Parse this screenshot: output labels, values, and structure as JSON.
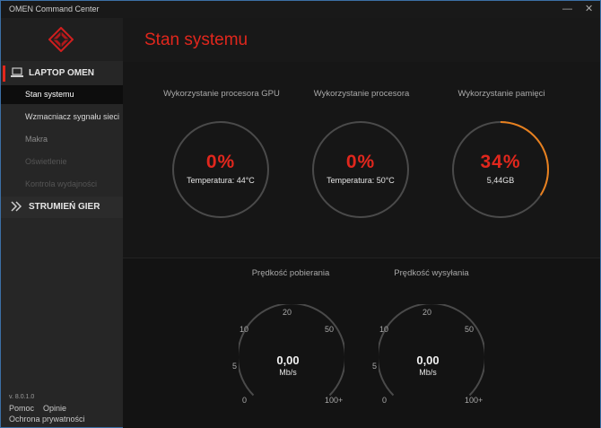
{
  "window": {
    "title": "OMEN Command Center"
  },
  "colors": {
    "accent": "#e1271d",
    "ring_progress": "#e8801e",
    "ring_track": "#4a4a4a"
  },
  "sidebar": {
    "sections": [
      {
        "label": "LAPTOP OMEN",
        "icon": "laptop-icon"
      },
      {
        "label": "STRUMIEŃ GIER",
        "icon": "stream-icon"
      }
    ],
    "items": [
      {
        "label": "Stan systemu",
        "state": "active"
      },
      {
        "label": "Wzmacniacz sygnału sieci",
        "state": "normal"
      },
      {
        "label": "Makra",
        "state": "dim"
      },
      {
        "label": "Oświetlenie",
        "state": "disabled"
      },
      {
        "label": "Kontrola wydajności",
        "state": "disabled"
      }
    ],
    "version": "v. 8.0.1.0",
    "links": {
      "help": "Pomoc",
      "feedback": "Opinie",
      "privacy": "Ochrona prywatności"
    }
  },
  "main": {
    "title": "Stan systemu",
    "gauges": [
      {
        "label": "Wykorzystanie procesora GPU",
        "value": "0%",
        "sub": "Temperatura: 44°C",
        "fraction": 0
      },
      {
        "label": "Wykorzystanie procesora",
        "value": "0%",
        "sub": "Temperatura: 50°C",
        "fraction": 0
      },
      {
        "label": "Wykorzystanie pamięci",
        "value": "34%",
        "sub": "5,44GB",
        "fraction": 0.34
      }
    ],
    "speeds": [
      {
        "label": "Prędkość pobierania",
        "value": "0,00",
        "unit": "Mb/s"
      },
      {
        "label": "Prędkość wysyłania",
        "value": "0,00",
        "unit": "Mb/s"
      }
    ],
    "speed_ticks": [
      "0",
      "5",
      "10",
      "20",
      "50",
      "100+"
    ]
  }
}
